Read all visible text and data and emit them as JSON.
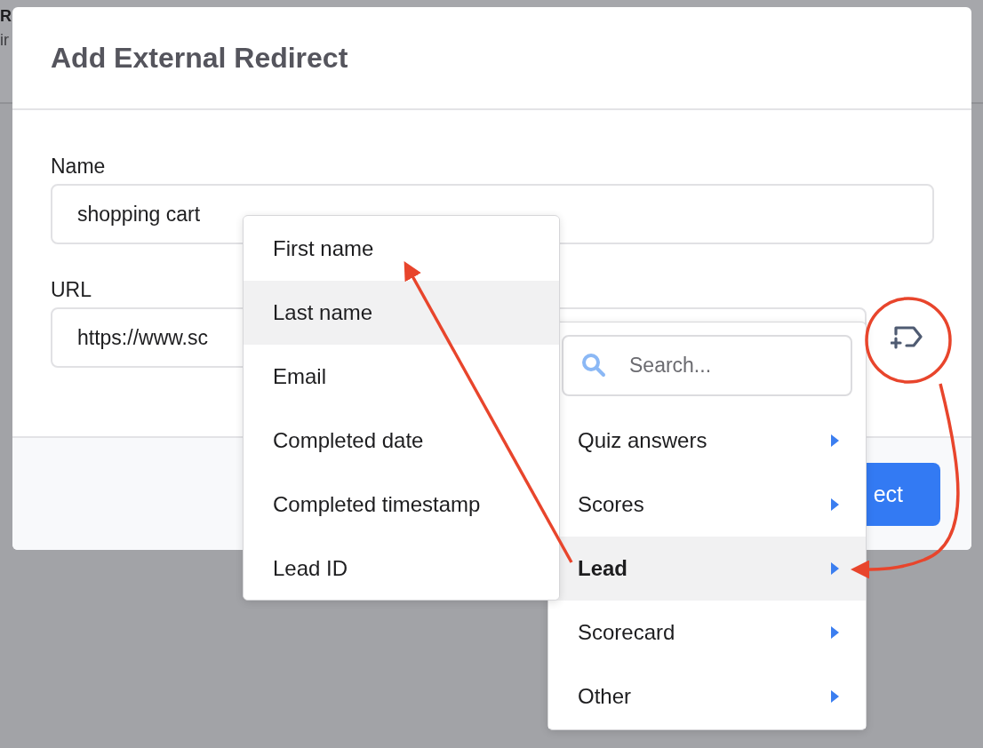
{
  "background_page": {
    "title": "R",
    "subtitle": "ir"
  },
  "dialog": {
    "title": "Add External Redirect",
    "fields": [
      {
        "label": "Name",
        "value": "shopping cart"
      },
      {
        "label": "URL",
        "value": "https://www.sc"
      }
    ],
    "submit_button": "ect"
  },
  "variable_menu": {
    "search": {
      "placeholder": "Search..."
    },
    "items": [
      {
        "label": "Quiz answers",
        "selected": false
      },
      {
        "label": "Scores",
        "selected": false
      },
      {
        "label": "Lead",
        "selected": true
      },
      {
        "label": "Scorecard",
        "selected": false
      },
      {
        "label": "Other",
        "selected": false
      }
    ]
  },
  "submenu": {
    "items": [
      {
        "label": "First name",
        "highlighted": false
      },
      {
        "label": "Last name",
        "highlighted": true
      },
      {
        "label": "Email",
        "highlighted": false
      },
      {
        "label": "Completed date",
        "highlighted": false
      },
      {
        "label": "Completed timestamp",
        "highlighted": false
      },
      {
        "label": "Lead ID",
        "highlighted": false
      }
    ]
  }
}
